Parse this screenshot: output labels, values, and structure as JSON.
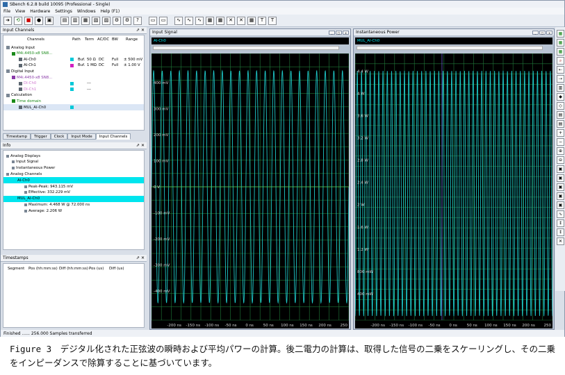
{
  "app_title": "SBench 6.2.8 build 10095 (Professional - Single)",
  "menu": [
    "File",
    "View",
    "Hardware",
    "Settings",
    "Windows",
    "Help (F1)"
  ],
  "toolbar_icons": [
    "arrow-right-icon",
    "play-icon",
    "stop-icon",
    "record-icon",
    "lock-icon",
    "card-icon",
    "card2-icon",
    "card3-icon",
    "chip-icon",
    "chip2-icon",
    "settings-icon",
    "settings2-icon",
    "help-icon",
    "disk-icon",
    "disk2-icon",
    "wave-icon",
    "wave2-icon",
    "wave3-icon",
    "calc-icon",
    "calc2-icon",
    "fft-icon",
    "cross-icon",
    "table-icon",
    "table2-icon",
    "table3-icon"
  ],
  "input_channels": {
    "title": "Input Channels",
    "headers": [
      "Channels",
      "Path",
      "Term",
      "AC/DC",
      "BW",
      "Range"
    ],
    "rows": [
      {
        "label": "Analog Input",
        "level": 1,
        "color": ""
      },
      {
        "label": "M4i.4450-x8 SN8...",
        "level": 2,
        "color": "#1a8a1a"
      },
      {
        "label": "AI-Ch0",
        "level": 3,
        "square": "#00c8d8",
        "path": "Buf.",
        "term": "50 Ω",
        "acdc": "DC",
        "bw": "Full",
        "range": "± 500 mV"
      },
      {
        "label": "AI-Ch1",
        "level": 3,
        "square": "#d020c0",
        "path": "Buf.",
        "term": "1 MΩ",
        "acdc": "DC",
        "bw": "Full",
        "range": "± 1.00 V"
      },
      {
        "label": "Digital Input",
        "level": 1,
        "color": ""
      },
      {
        "label": "M4i.4450-x8 SN8...",
        "level": 2,
        "color": "#8a3aa8"
      },
      {
        "label": "DI-Ch0",
        "level": 3,
        "square": "#00c8d8",
        "path": "---",
        "faded": true
      },
      {
        "label": "DI-Ch1",
        "level": 3,
        "square": "#00c8d8",
        "path": "---",
        "faded": true
      },
      {
        "label": "Calculation",
        "level": 1,
        "color": ""
      },
      {
        "label": "Time domain",
        "level": 2,
        "color": "#1a8a1a"
      },
      {
        "label": "MUL_AI-Ch0",
        "level": 3,
        "square": "#00c8d8",
        "selected": true
      }
    ],
    "tabs": [
      "Timestamp",
      "Trigger",
      "Clock",
      "Input Mode",
      "Input Channels"
    ]
  },
  "info": {
    "title": "Info",
    "rows": [
      {
        "label": "Analog Displays",
        "level": 1
      },
      {
        "label": "Input Signal",
        "level": 2
      },
      {
        "label": "Instantaneous Power",
        "level": 2
      },
      {
        "label": "Analog Channels",
        "level": 1
      },
      {
        "label": "AI-Ch0",
        "level": 2,
        "bar": true
      },
      {
        "label": "Peak-Peak: 943.115 mV",
        "level": 3
      },
      {
        "label": "Effective: 332.229 mV",
        "level": 3
      },
      {
        "label": "MUL_AI-Ch0",
        "level": 2,
        "bar": true
      },
      {
        "label": "Maximum: 4.468 W @ 72.000 ns",
        "level": 3
      },
      {
        "label": "Average: 2.206 W",
        "level": 3
      }
    ]
  },
  "timestamps": {
    "title": "Timestamps",
    "headers": [
      "Segment",
      "Pos (hh:mm:ss)",
      "Diff (hh:mm:ss)",
      "Pos (us)",
      "Diff (us)"
    ]
  },
  "status": "Finished ...... 256.000 Samples transferred",
  "input_signal": {
    "title": "Input Signal",
    "channel": "AI-Ch0",
    "y_ticks": [
      "400 mV",
      "300 mV",
      "200 mV",
      "100 mV",
      "0 V",
      "-100 mV",
      "-200 mV",
      "-300 mV",
      "-400 mV"
    ],
    "x_ticks": [
      "-200 ns",
      "-150 ns",
      "-100 ns",
      "-50 ns",
      "0 ns",
      "50 ns",
      "100 ns",
      "150 ns",
      "200 ns",
      "250"
    ]
  },
  "inst_power": {
    "title": "Instantaneous Power",
    "channel": "MUL_AI-Ch0",
    "y_ticks": [
      "4.4 W",
      "4 W",
      "3.6 W",
      "3.2 W",
      "2.8 W",
      "2.4 W",
      "2 W",
      "1.6 W",
      "1.2 W",
      "800 mW",
      "400 mW"
    ],
    "x_ticks": [
      "-200 ns",
      "-150 ns",
      "-100 ns",
      "-50 ns",
      "0 ns",
      "50 ns",
      "100 ns",
      "150 ns",
      "200 ns",
      "250"
    ]
  },
  "right_toolbar_icons": [
    "grid-icon",
    "grid2-icon",
    "grid3-icon",
    "magnify-icon",
    "cursor-icon",
    "cursor2-icon",
    "bars-icon",
    "mark-icon",
    "mark2-icon",
    "print-icon",
    "print2-icon",
    "plus-icon",
    "minus-icon",
    "zoom-in-icon",
    "zoom-out-icon",
    "fit-icon",
    "fit2-icon",
    "fit3-icon",
    "fit4-icon",
    "fit5-icon",
    "sine-icon",
    "cursor3-icon",
    "cursor4-icon",
    "close-icon"
  ],
  "caption": "Figure 3　デジタル化された正弦波の瞬時および平均パワーの計算。後二電力の計算は、取得した信号の二乗をスケーリングし、その二乗をインピーダンスで除算することに基づいています。",
  "colors": {
    "trace": "#1ec8c8",
    "grid": "#1f7a3a",
    "zero": "#5ad05a",
    "highlight": "#00e5ee"
  }
}
